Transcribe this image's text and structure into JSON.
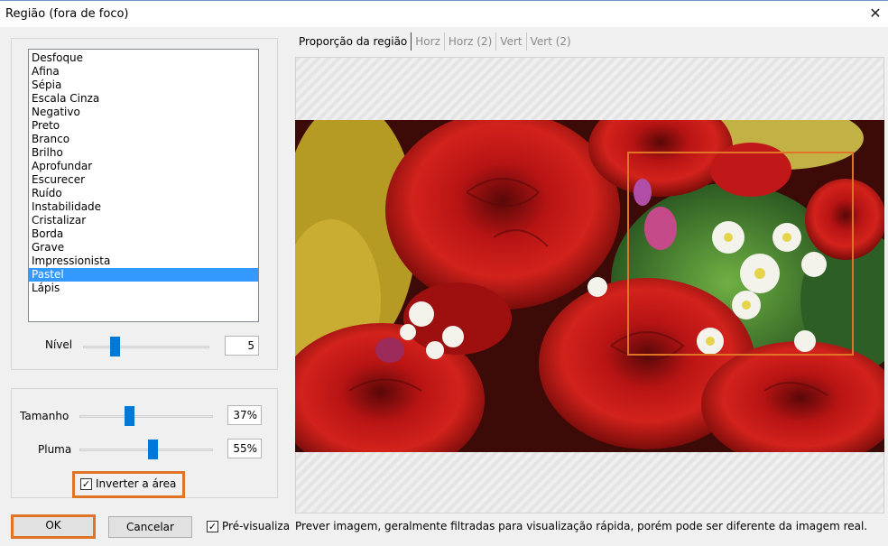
{
  "window": {
    "title": "Região (fora de foco)",
    "close_glyph": "✕"
  },
  "effects": {
    "items": [
      "Desfoque",
      "Afina",
      "Sépia",
      "Escala Cinza",
      "Negativo",
      "Preto",
      "Branco",
      "Brilho",
      "Aprofundar",
      "Escurecer",
      "Ruído",
      "Instabilidade",
      "Cristalizar",
      "Borda",
      "Grave",
      "Impressionista",
      "Pastel",
      "Lápis"
    ],
    "selected": "Pastel"
  },
  "nivel": {
    "label": "Nível",
    "value": "5",
    "level": 0.25
  },
  "tamanho": {
    "label": "Tamanho",
    "value": "37%",
    "level": 0.37
  },
  "pluma": {
    "label": "Pluma",
    "value": "55%",
    "level": 0.55
  },
  "invert": {
    "label": "Inverter a área",
    "checked": true
  },
  "buttons": {
    "ok": "OK",
    "cancel": "Cancelar"
  },
  "preview_check": {
    "label": "Pré-visualiza",
    "checked": true
  },
  "tabs": [
    "Proporção da região",
    "Horz",
    "Horz (2)",
    "Vert",
    "Vert (2)"
  ],
  "hint": "Prever imagem, geralmente filtradas para visualização rápida, porém pode ser diferente da imagem real.",
  "colors": {
    "accent": "#e07326",
    "selection": "#3399ff",
    "slider": "#0078d7"
  }
}
